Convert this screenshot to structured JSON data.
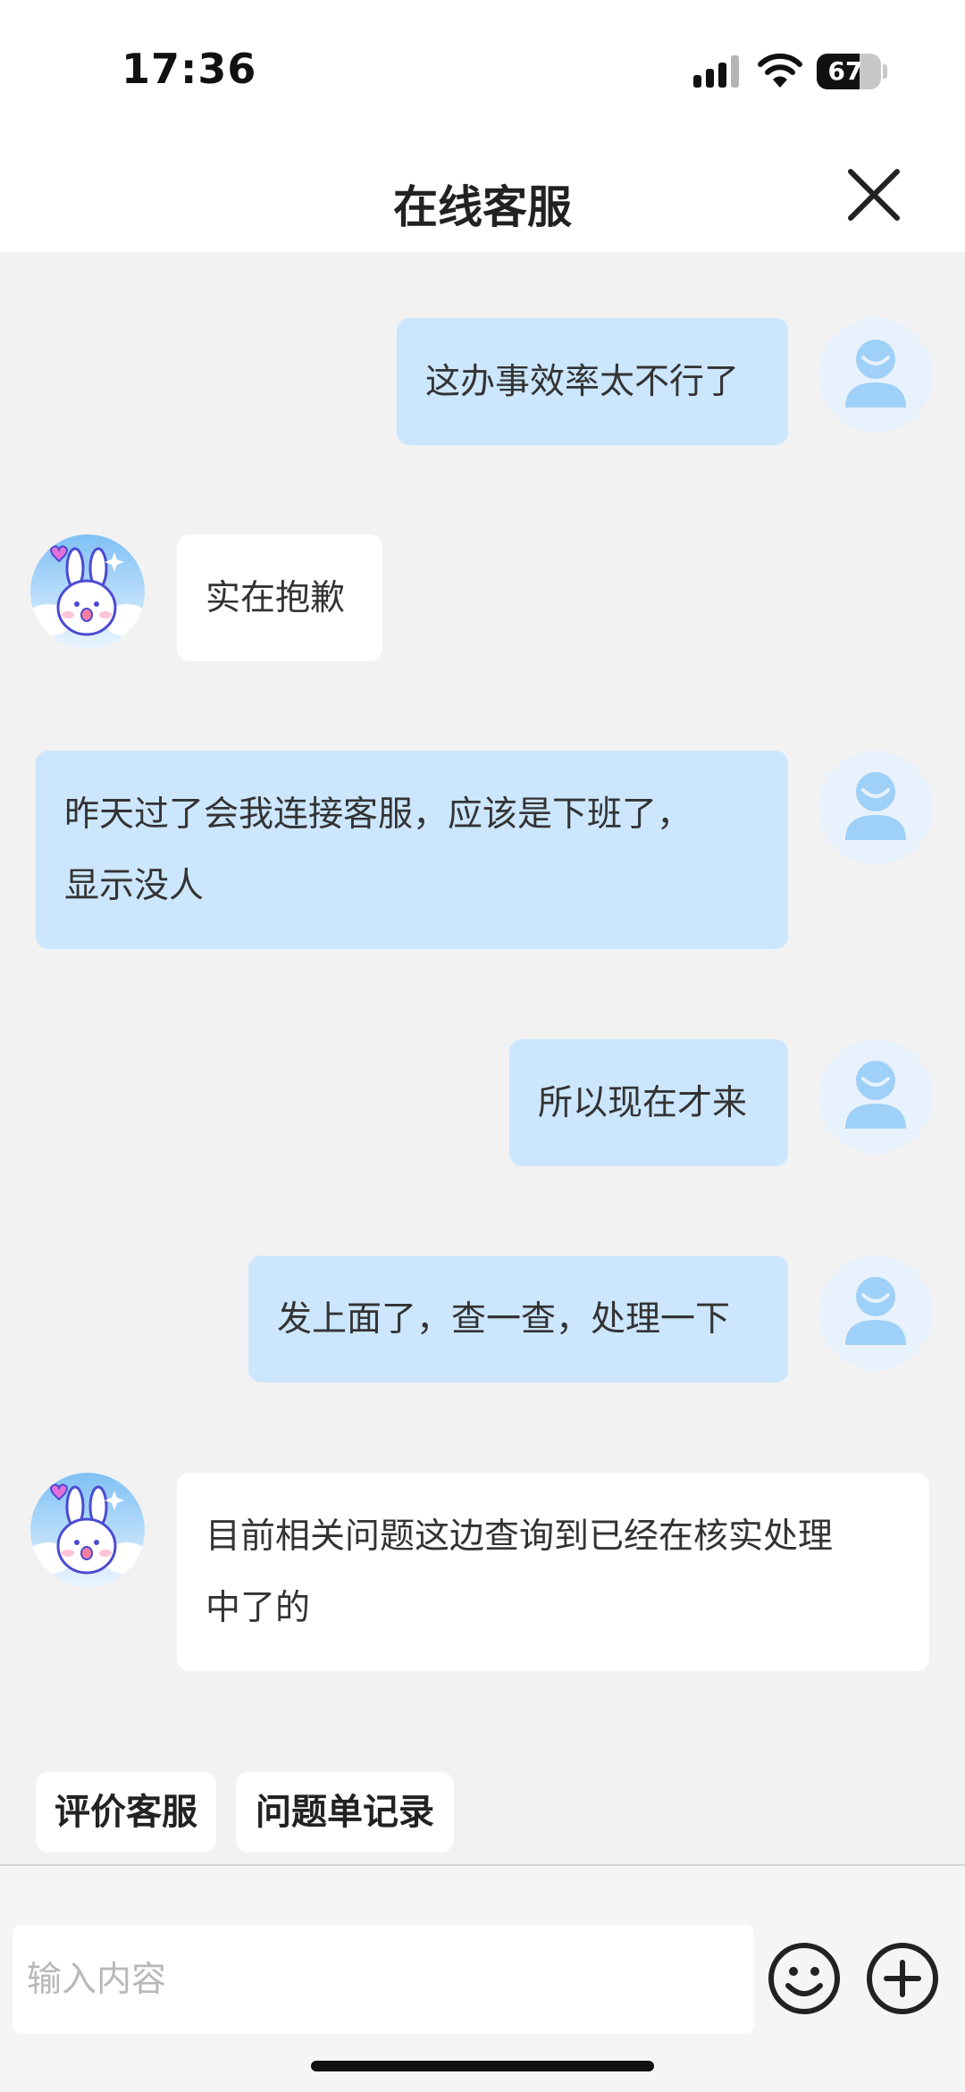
{
  "status_bar": {
    "time": "17:36",
    "battery": "67",
    "battery_level": 0.67
  },
  "header": {
    "title": "在线客服"
  },
  "messages": [
    {
      "from": "user",
      "text": "这办事效率太不行了"
    },
    {
      "from": "agent",
      "text": "实在抱歉"
    },
    {
      "from": "user",
      "lines": [
        "昨天过了会我连接客服，应该是下班了，",
        "显示没人"
      ]
    },
    {
      "from": "user",
      "text": "所以现在才来"
    },
    {
      "from": "user",
      "text": "发上面了，查一查，处理一下"
    },
    {
      "from": "agent",
      "lines": [
        "目前相关问题这边查询到已经在核实处理",
        "中了的"
      ]
    }
  ],
  "quick_actions": {
    "rate": "评价客服",
    "tickets": "问题单记录"
  },
  "composer": {
    "placeholder": "输入内容",
    "value": ""
  },
  "colors": {
    "user_bubble": "#cce6fd",
    "agent_bubble": "#ffffff",
    "background": "#f2f2f2",
    "avatar_blue": "#9fd0f8"
  }
}
